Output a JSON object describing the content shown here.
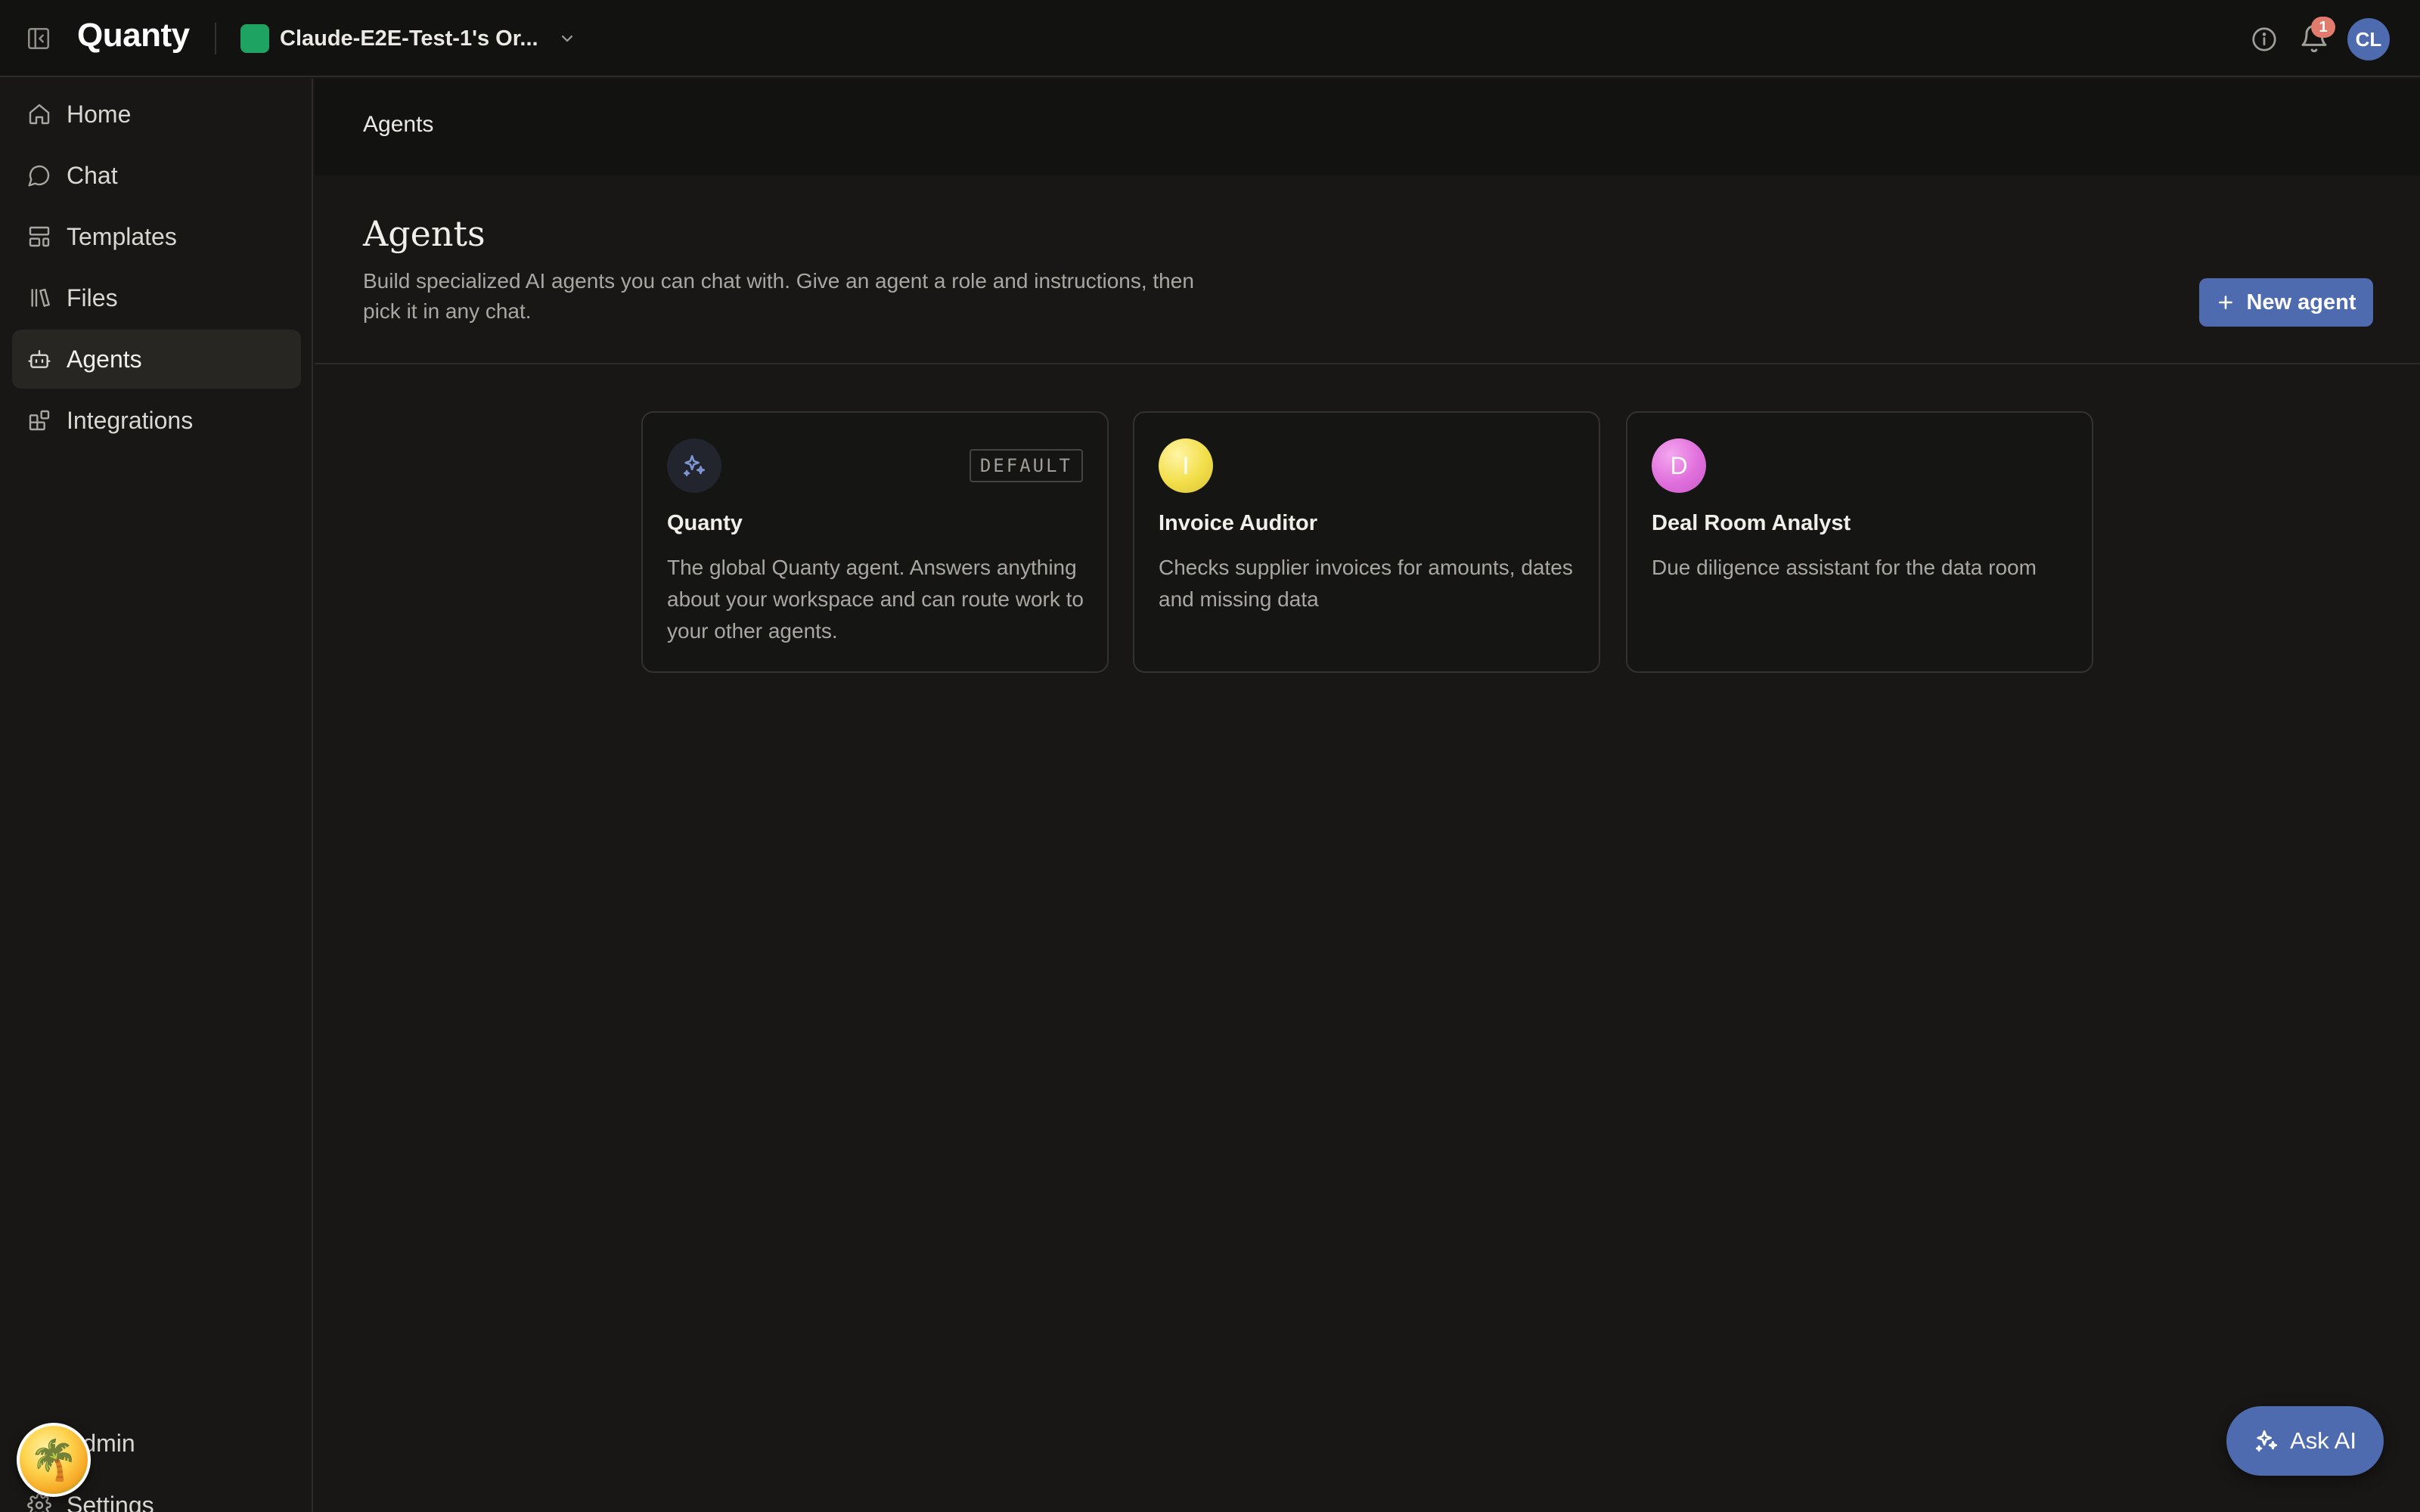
{
  "app": {
    "logo": "Quanty",
    "org_name": "Claude-E2E-Test-1's Or...",
    "colors": {
      "accent": "#4d6bae",
      "org_swatch": "#1fa363",
      "badge": "#e07b6e"
    }
  },
  "topbar": {
    "notification_count": "1",
    "avatar_initials": "CL",
    "icons": [
      "sidebar-toggle-icon",
      "chevron-down-icon",
      "info-icon",
      "bell-icon"
    ]
  },
  "sidebar": {
    "items": [
      {
        "label": "Home",
        "icon": "home-icon"
      },
      {
        "label": "Chat",
        "icon": "chat-bubble-icon"
      },
      {
        "label": "Templates",
        "icon": "layout-template-icon"
      },
      {
        "label": "Files",
        "icon": "library-icon"
      },
      {
        "label": "Agents",
        "icon": "bot-icon",
        "active": true
      },
      {
        "label": "Integrations",
        "icon": "blocks-icon"
      }
    ],
    "bottom_items": [
      {
        "label": "Admin",
        "icon": "shield-check-icon"
      },
      {
        "label": "Settings",
        "icon": "settings-icon"
      }
    ]
  },
  "main": {
    "breadcrumb": "Agents",
    "title": "Agents",
    "description": "Build specialized AI agents you can chat with. Give an agent a role and instructions, then pick it in any chat.",
    "new_agent_label": "New agent",
    "agents": [
      {
        "name": "Quanty",
        "badge": "DEFAULT",
        "initial": "",
        "avatar_icon": "sparkle-icon",
        "description": "The global Quanty agent. Answers anything about your workspace and can route work to your other agents."
      },
      {
        "name": "Invoice Auditor",
        "initial": "I",
        "description": "Checks supplier invoices for amounts, dates and missing data"
      },
      {
        "name": "Deal Room Analyst",
        "initial": "D",
        "description": "Due diligence assistant for the data room"
      }
    ]
  },
  "ask_ai": {
    "label": "Ask AI"
  }
}
